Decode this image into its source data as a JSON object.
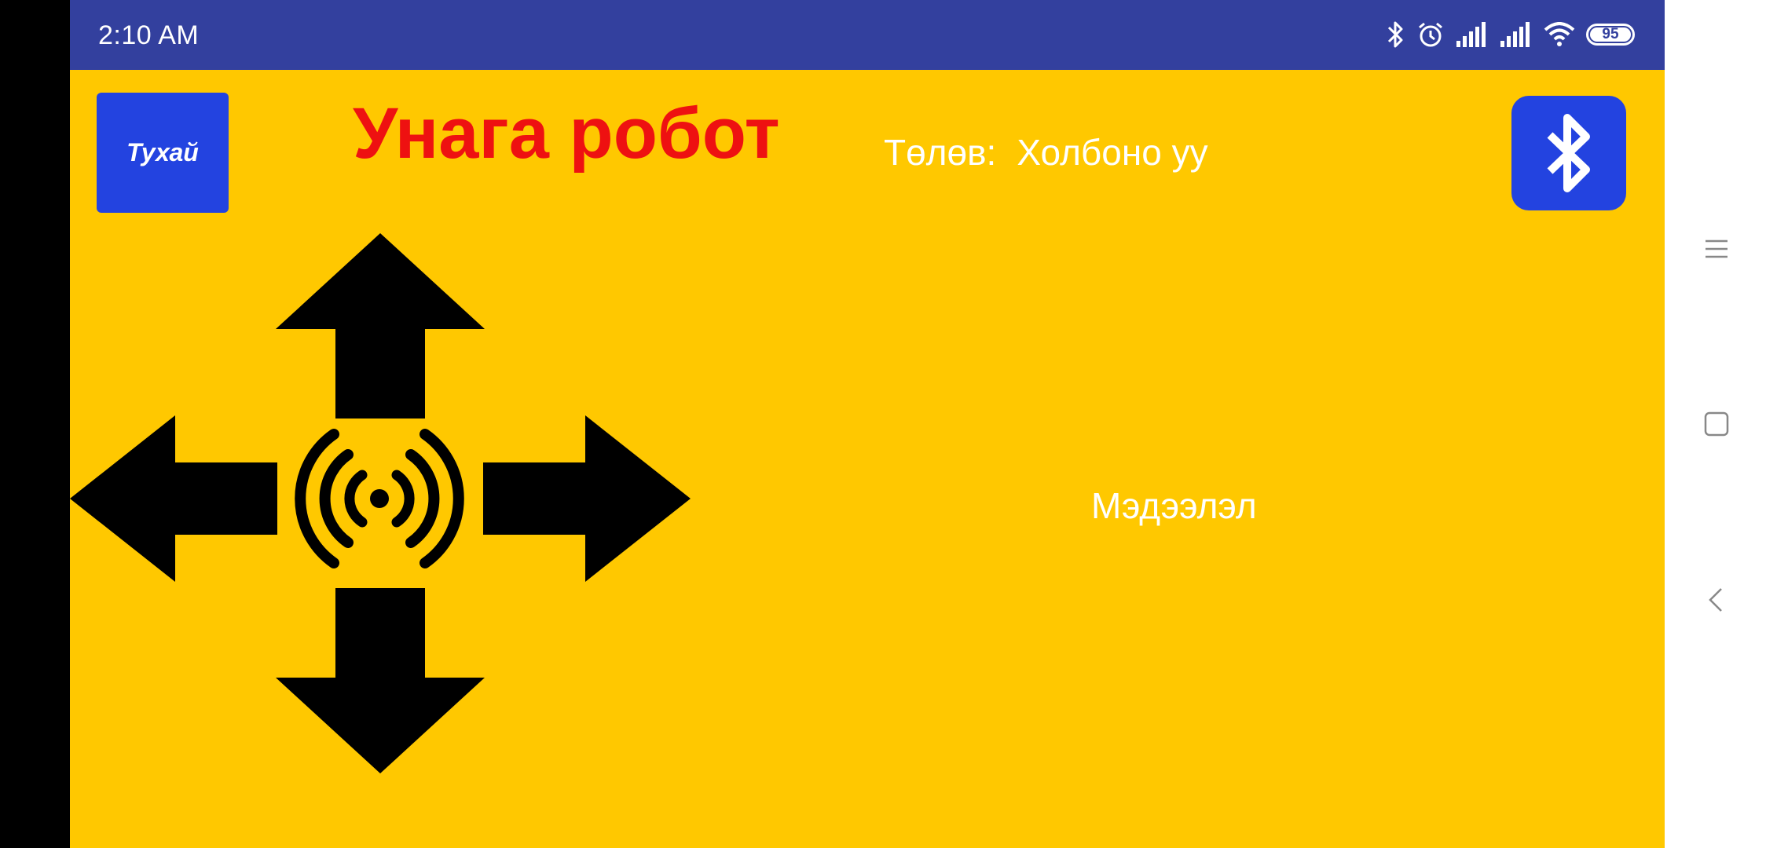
{
  "status_bar": {
    "time": "2:10 AM",
    "battery": "95",
    "icons": [
      "bluetooth-icon",
      "alarm-icon",
      "signal-icon",
      "signal-icon",
      "wifi-icon",
      "battery-icon"
    ]
  },
  "app": {
    "about_button_label": "Тухай",
    "title": "Унага робот",
    "status_label": "Төлөв:",
    "status_value": "Холбоно уу",
    "info_label": "Мэдээлэл",
    "bluetooth_button_icon": "bluetooth-icon",
    "controls": [
      "arrow-up-icon",
      "arrow-down-icon",
      "arrow-left-icon",
      "arrow-right-icon",
      "signal-waves-icon"
    ],
    "colors": {
      "background": "#ffc800",
      "title": "#ee1111",
      "button": "#2343e0",
      "status_bar": "#33409e",
      "control": "#000000",
      "text": "#ffffff"
    }
  },
  "system_nav": {
    "buttons": [
      "menu-icon",
      "home-icon",
      "back-icon"
    ]
  }
}
